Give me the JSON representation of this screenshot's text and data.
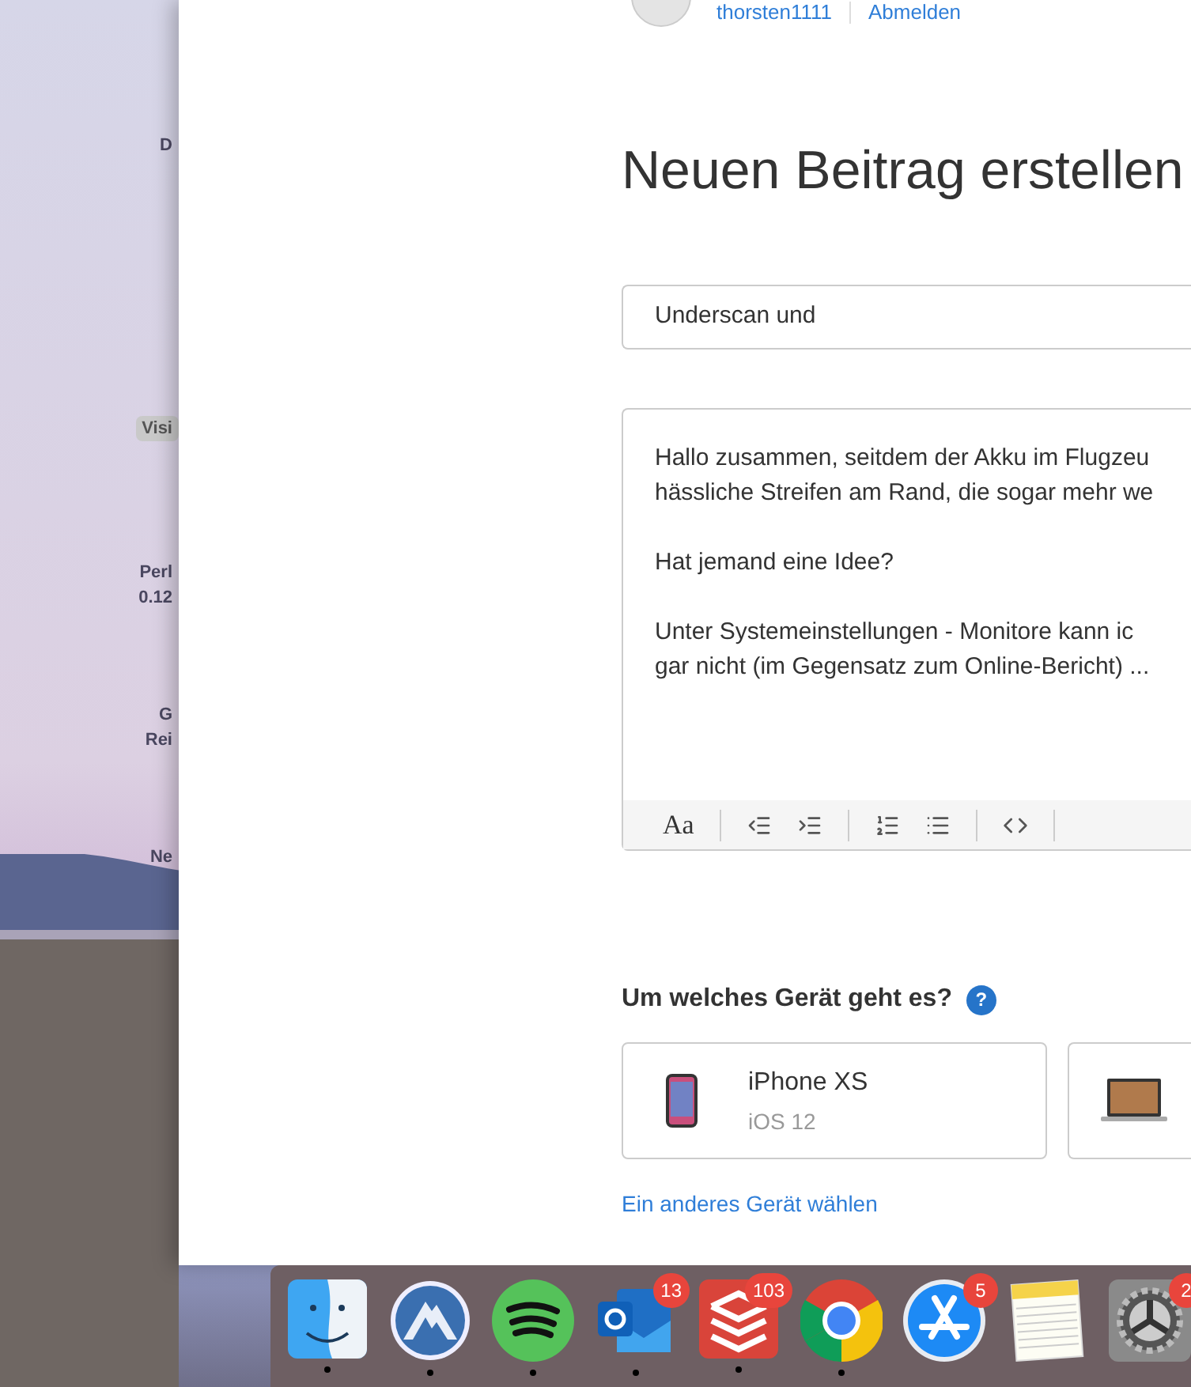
{
  "desktop_icons": [
    {
      "label": "D",
      "selected": false
    },
    {
      "label": "Visi",
      "selected": true
    },
    {
      "label": "Perl\n0.12",
      "selected": false
    },
    {
      "label": "G\nRei",
      "selected": false
    },
    {
      "label": "Ne",
      "selected": false
    }
  ],
  "header": {
    "username": "thorsten1111",
    "logout": "Abmelden"
  },
  "title": "Neuen Beitrag erstellen",
  "subject": {
    "value": "Underscan und"
  },
  "editor": {
    "paragraphs": [
      "Hallo zusammen, seitdem der Akku im Flugzeu\nhässliche Streifen am Rand, die sogar mehr we",
      "Hat jemand eine Idee?",
      "Unter Systemeinstellungen - Monitore kann ic\ngar nicht (im Gegensatz zum Online-Bericht) ..."
    ],
    "toolbar": [
      {
        "kind": "text",
        "label": "Aa"
      },
      {
        "kind": "divider"
      },
      {
        "kind": "outdent"
      },
      {
        "kind": "indent"
      },
      {
        "kind": "divider"
      },
      {
        "kind": "numbered-list"
      },
      {
        "kind": "bullet-list"
      },
      {
        "kind": "divider"
      },
      {
        "kind": "code"
      },
      {
        "kind": "divider"
      }
    ]
  },
  "device_question": {
    "label": "Um welches Gerät geht es?",
    "help": "?"
  },
  "devices": [
    {
      "kind": "phone",
      "name": "iPhone XS",
      "os": "iOS 12"
    },
    {
      "kind": "laptop"
    }
  ],
  "other_device_link": "Ein anderes Gerät wählen",
  "dock": [
    {
      "kind": "finder",
      "running": true
    },
    {
      "kind": "vpn",
      "running": true
    },
    {
      "kind": "spotify",
      "running": true
    },
    {
      "kind": "outlook",
      "running": true,
      "badge": "13"
    },
    {
      "kind": "todoist",
      "running": true,
      "badge": "103"
    },
    {
      "kind": "chrome",
      "running": true
    },
    {
      "kind": "appstore",
      "running": false,
      "badge": "5"
    },
    {
      "kind": "notes",
      "running": false
    },
    {
      "kind": "settings",
      "running": false,
      "badge": "2"
    }
  ]
}
